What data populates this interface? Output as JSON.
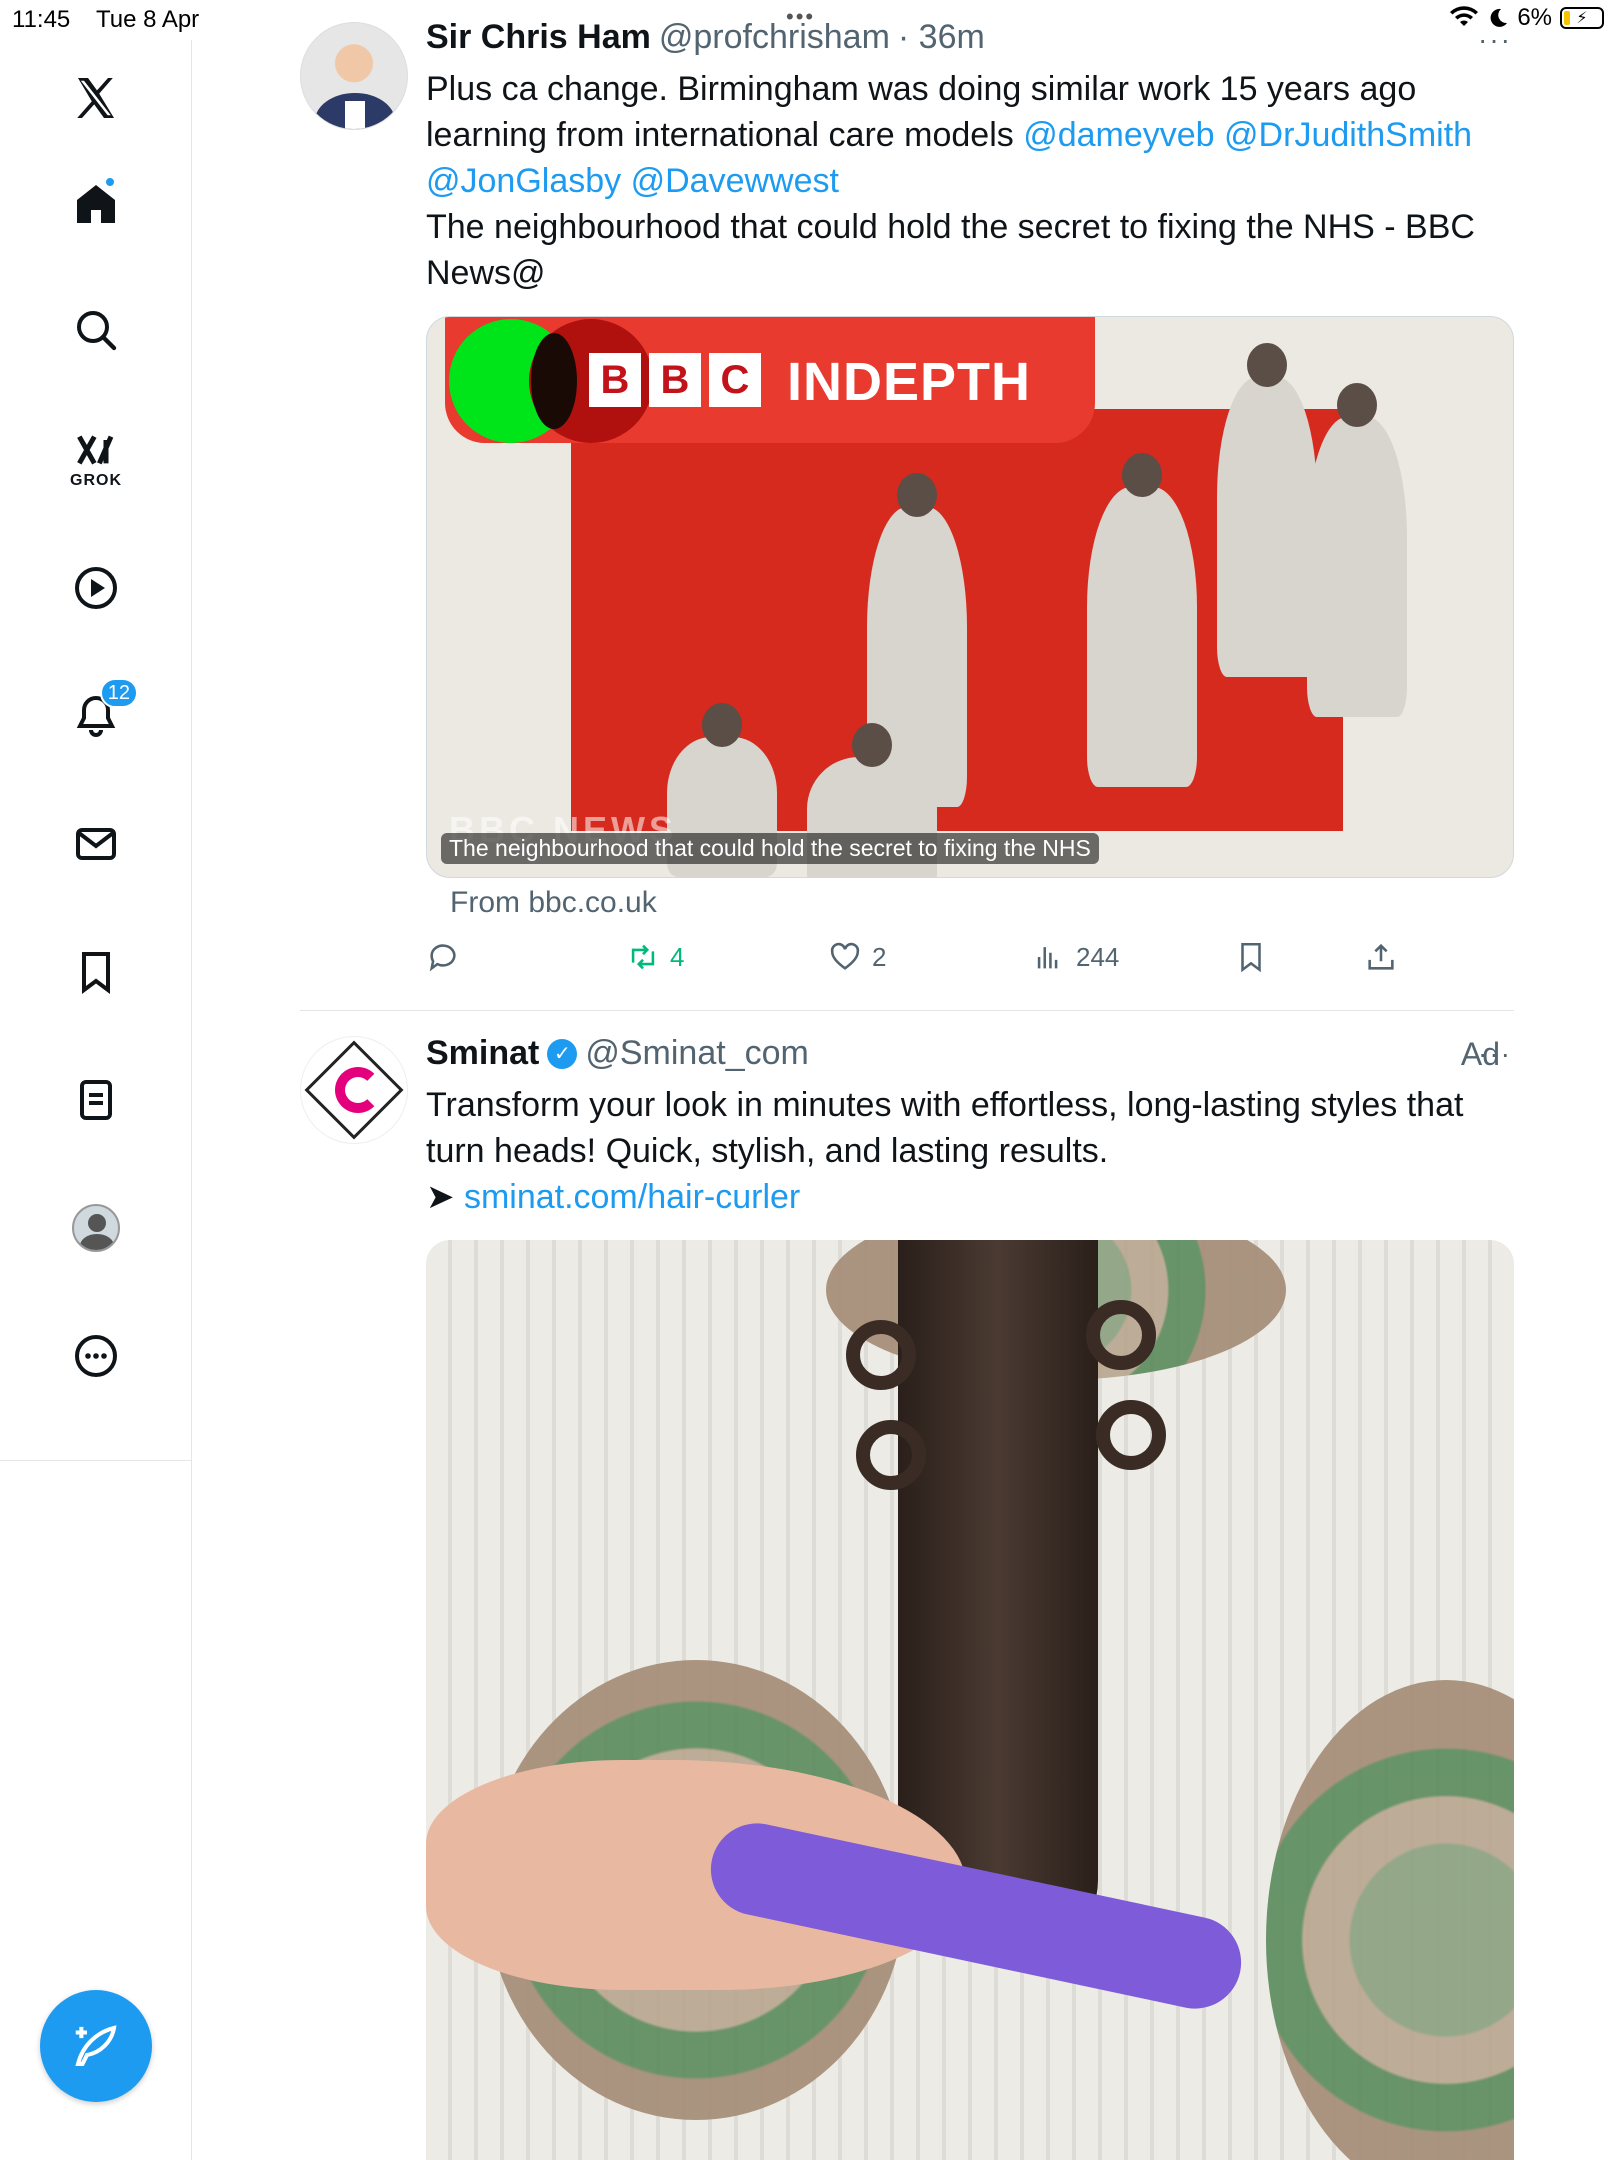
{
  "status_bar": {
    "time": "11:45",
    "date": "Tue 8 Apr",
    "battery": "6%"
  },
  "sidebar": {
    "grok_label": "GROK",
    "notifications_count": "12"
  },
  "tweet1": {
    "display_name": "Sir Chris Ham",
    "handle": "@profchrisham",
    "time": "· 36m",
    "text_line1": "Plus ca change. Birmingham was doing similar work 15 years ago",
    "text_line2_prefix": "learning from international care models ",
    "mention1": "@dameyveb",
    "mention2": "@DrJudithSmith",
    "mention3": "@JonGlasby",
    "mention4": "@Davewwest",
    "text_line4": "The neighbourhood that could hold the secret to fixing the NHS - BBC",
    "text_line5": "News@",
    "card": {
      "brand_letters": [
        "B",
        "B",
        "C"
      ],
      "brand_title": "INDEPTH",
      "news_watermark": "BBC NEWS",
      "caption": "The neighbourhood that could hold the secret to fixing the NHS",
      "source": "From bbc.co.uk"
    },
    "stats": {
      "retweets": "4",
      "likes": "2",
      "views": "244"
    }
  },
  "tweet2": {
    "display_name": "Sminat",
    "handle": "@Sminat_com",
    "ad_label": "Ad",
    "text_line1": "Transform your look in minutes with effortless, long-lasting styles that",
    "text_line2": "turn heads! Quick, stylish, and lasting results.",
    "arrow": "➤ ",
    "link": "sminat.com/hair-curler"
  },
  "colors": {
    "accent": "#1d9bf0",
    "retweet_green": "#00ba7c",
    "bbc_red": "#d62a1e"
  },
  "icons": [
    "x-logo-icon",
    "home-icon",
    "search-icon",
    "grok-icon",
    "video-icon",
    "bell-icon",
    "mail-icon",
    "bookmark-icon",
    "lists-icon",
    "profile-icon",
    "more-icon",
    "compose-icon",
    "reply-icon",
    "retweet-icon",
    "like-icon",
    "views-icon",
    "share-icon"
  ]
}
